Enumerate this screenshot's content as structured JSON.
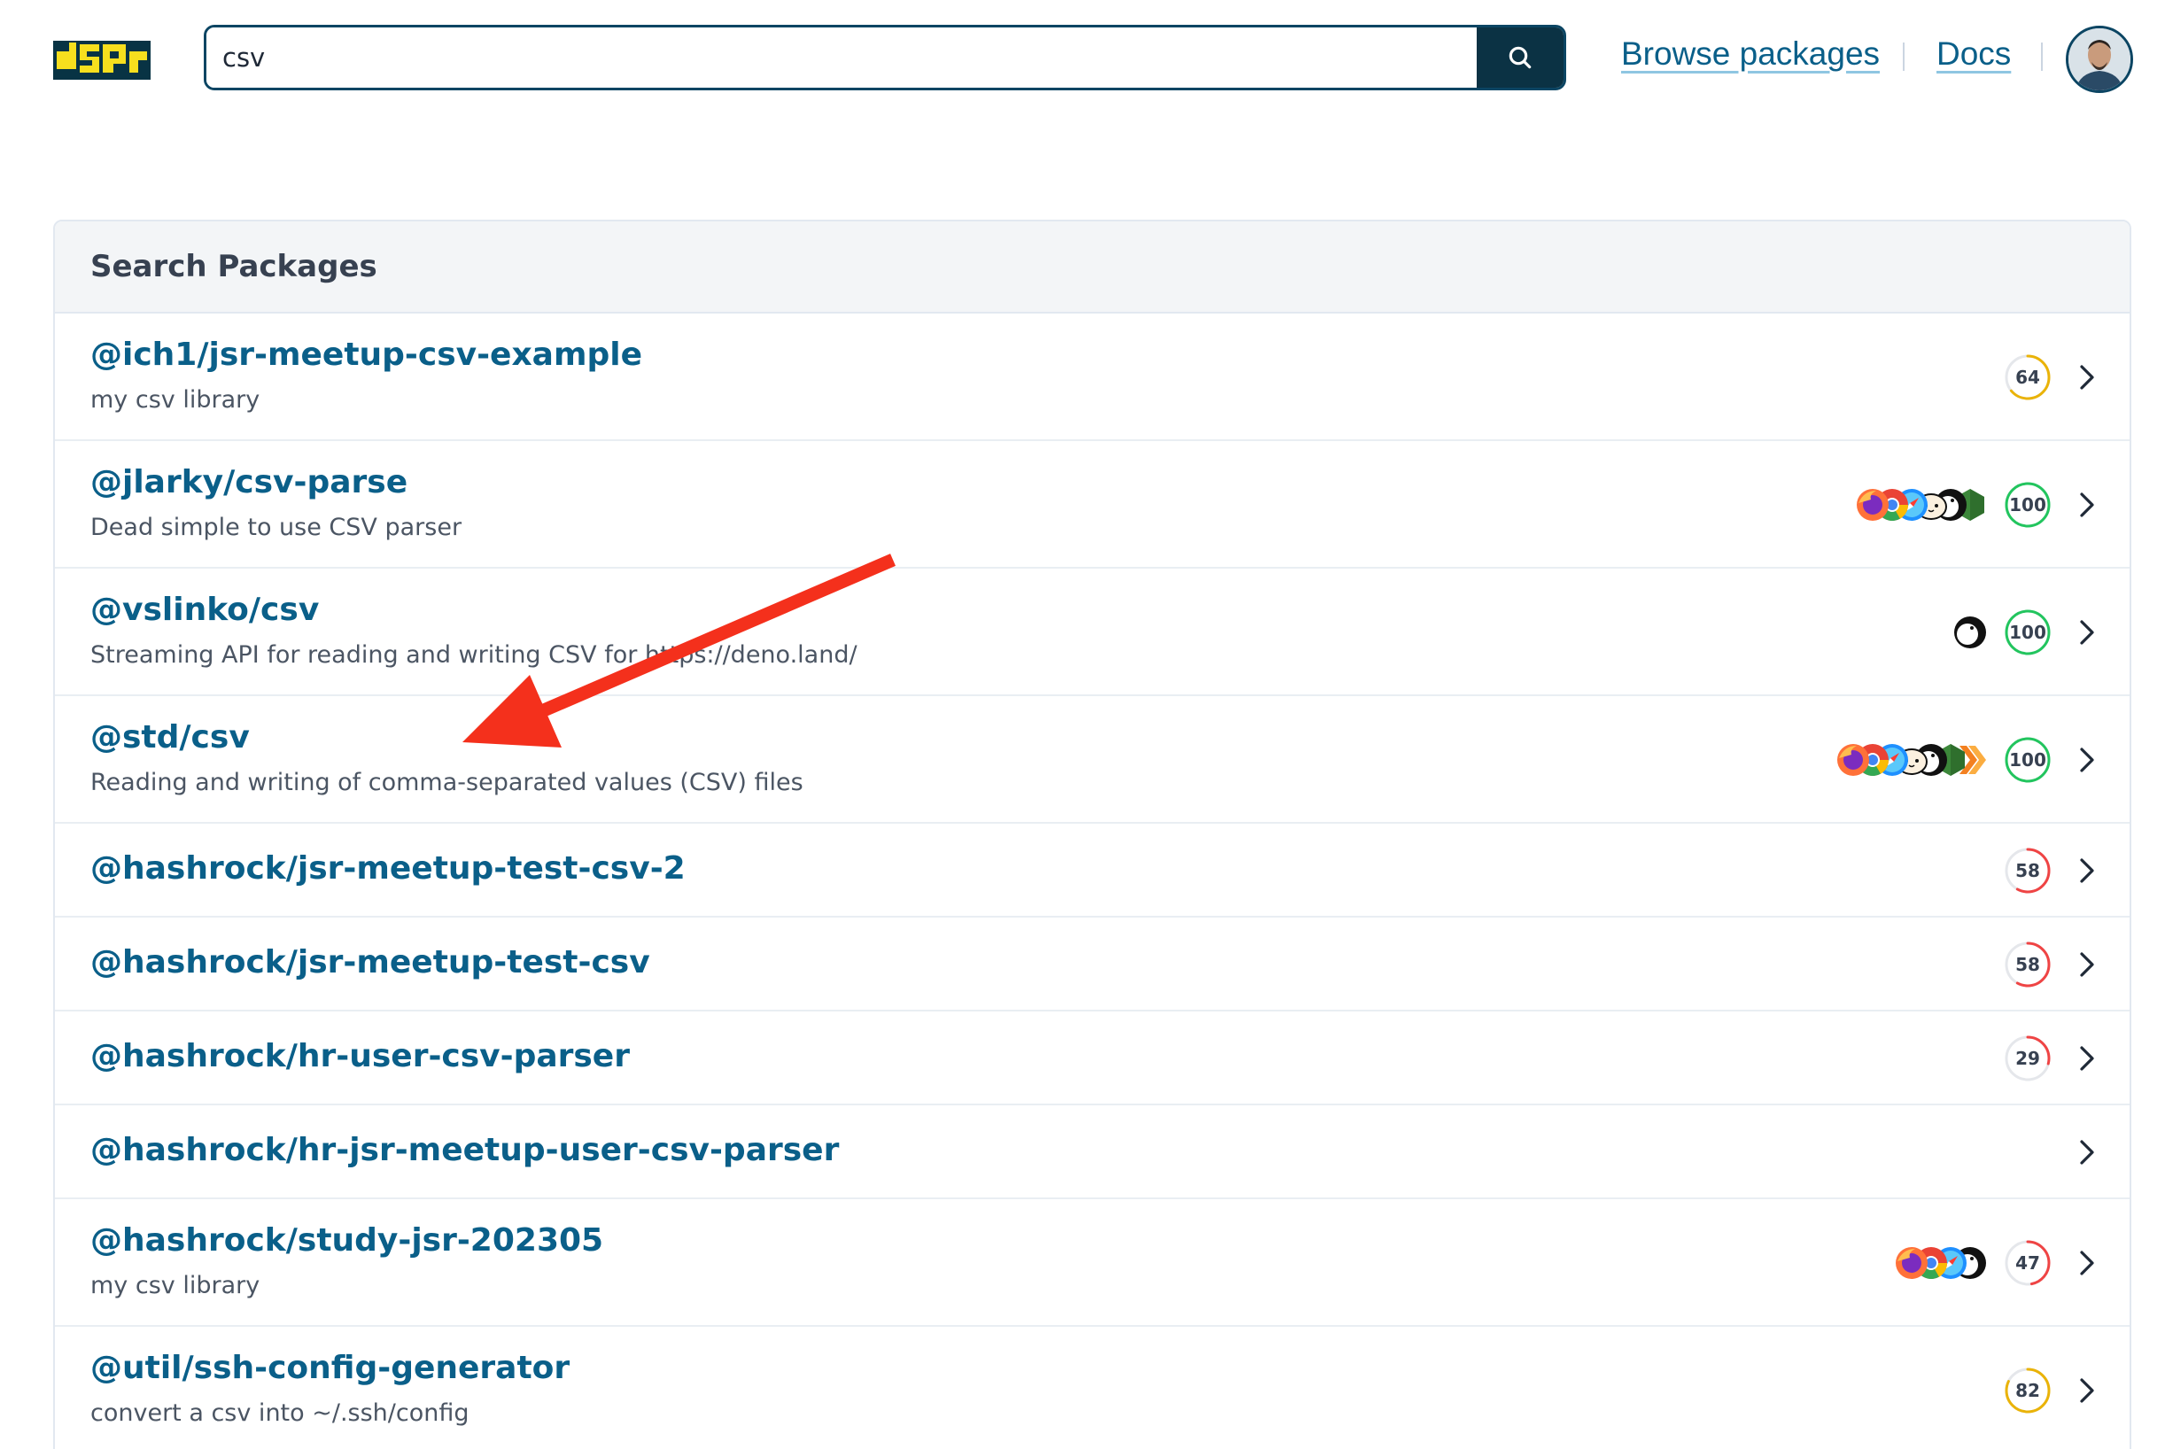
{
  "header": {
    "logo_alt": "jsr",
    "search": {
      "value": "csv",
      "placeholder": ""
    },
    "nav": [
      {
        "label": "Browse packages"
      },
      {
        "label": "Docs"
      }
    ]
  },
  "panel": {
    "title": "Search Packages"
  },
  "packages": [
    {
      "name": "@ich1/jsr-meetup-csv-example",
      "description": "my csv library",
      "score": "64",
      "score_value": 64,
      "score_color": "#eab308",
      "runtimes": []
    },
    {
      "name": "@jlarky/csv-parse",
      "description": "Dead simple to use CSV parser",
      "score": "100",
      "score_value": 100,
      "score_color": "#22c55e",
      "runtimes": [
        "firefox-icon",
        "chrome-icon",
        "safari-icon",
        "bun-icon",
        "deno-icon",
        "node-icon"
      ]
    },
    {
      "name": "@vslinko/csv",
      "description": "Streaming API for reading and writing CSV for https://deno.land/",
      "score": "100",
      "score_value": 100,
      "score_color": "#22c55e",
      "runtimes": [
        "deno-icon"
      ]
    },
    {
      "name": "@std/csv",
      "description": "Reading and writing of comma-separated values (CSV) files",
      "score": "100",
      "score_value": 100,
      "score_color": "#22c55e",
      "runtimes": [
        "firefox-icon",
        "chrome-icon",
        "safari-icon",
        "bun-icon",
        "deno-icon",
        "node-icon",
        "cloudflare-workers-icon"
      ]
    },
    {
      "name": "@hashrock/jsr-meetup-test-csv-2",
      "description": "",
      "score": "58",
      "score_value": 58,
      "score_color": "#ef4444",
      "runtimes": []
    },
    {
      "name": "@hashrock/jsr-meetup-test-csv",
      "description": "",
      "score": "58",
      "score_value": 58,
      "score_color": "#ef4444",
      "runtimes": []
    },
    {
      "name": "@hashrock/hr-user-csv-parser",
      "description": "",
      "score": "29",
      "score_value": 29,
      "score_color": "#ef4444",
      "runtimes": []
    },
    {
      "name": "@hashrock/hr-jsr-meetup-user-csv-parser",
      "description": "",
      "score": "",
      "score_value": null,
      "score_color": "",
      "runtimes": []
    },
    {
      "name": "@hashrock/study-jsr-202305",
      "description": "my csv library",
      "score": "47",
      "score_value": 47,
      "score_color": "#ef4444",
      "runtimes": [
        "firefox-icon",
        "chrome-icon",
        "safari-icon",
        "deno-icon"
      ]
    },
    {
      "name": "@util/ssh-config-generator",
      "description": "convert a csv into ~/.ssh/config",
      "score": "82",
      "score_value": 82,
      "score_color": "#eab308",
      "runtimes": []
    }
  ],
  "colors": {
    "brand": "#0a5f89",
    "logo_yellow": "#f7df1e",
    "logo_dark": "#083344",
    "annotation_arrow": "#f4301c"
  }
}
